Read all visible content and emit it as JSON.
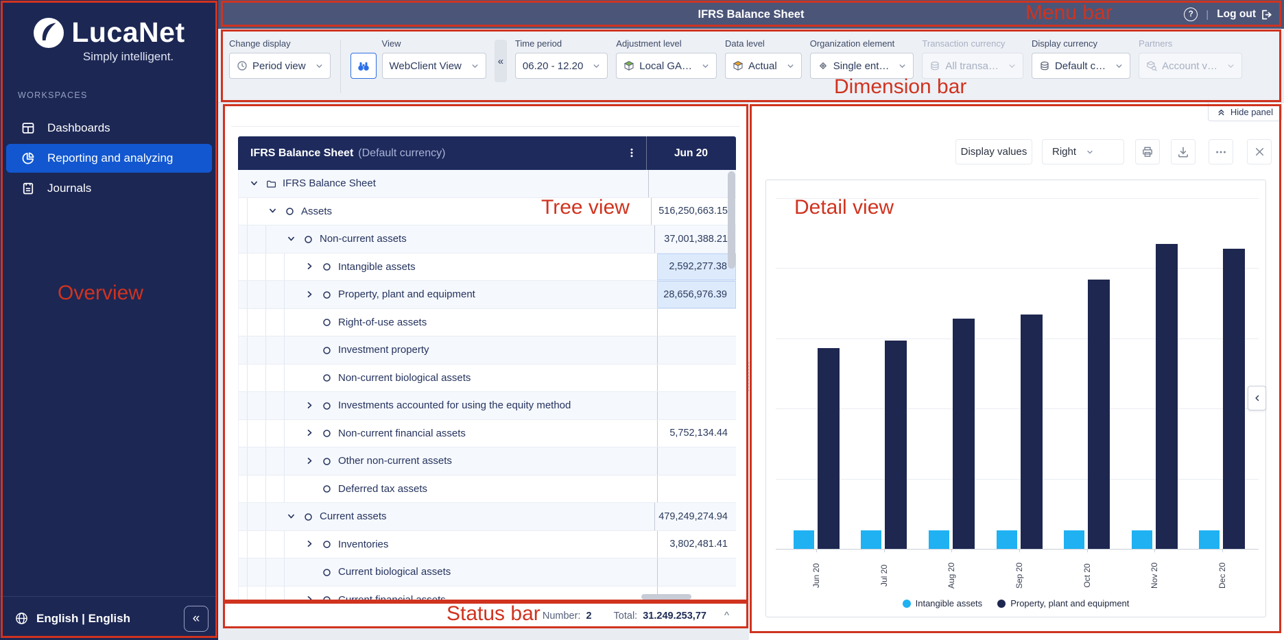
{
  "colors": {
    "accent": "#1257d0",
    "sidebar_bg": "#1c2754",
    "menubar_bg": "#4b5578",
    "tree_header_bg": "#1e2a5c",
    "bar_blue": "#1fb1f2",
    "bar_navy": "#1d2750",
    "annotation_red": "#d0331f"
  },
  "annotations": {
    "menu_bar": "Menu bar",
    "dimension_bar": "Dimension bar",
    "overview": "Overview",
    "tree_view": "Tree view",
    "detail_view": "Detail view",
    "status_bar": "Status bar"
  },
  "sidebar": {
    "logo_text": "LucaNet",
    "tagline": "Simply intelligent.",
    "section_label": "WORKSPACES",
    "items": [
      {
        "label": "Dashboards",
        "icon": "dashboard",
        "selected": false
      },
      {
        "label": "Reporting and analyzing",
        "icon": "pie",
        "selected": true
      },
      {
        "label": "Journals",
        "icon": "journal",
        "selected": false
      }
    ],
    "language": "English | English",
    "collapse_glyph": "«"
  },
  "menu_bar": {
    "title": "IFRS Balance Sheet",
    "help_glyph": "?",
    "divider_glyph": "|",
    "logout_label": "Log out"
  },
  "dimension_bar": {
    "controls": [
      {
        "type": "field",
        "label": "Change display",
        "value": "Period view",
        "icon": "clock",
        "disabled": false
      },
      {
        "type": "separator"
      },
      {
        "type": "field",
        "label": "View",
        "value": "WebClient View",
        "icon": null,
        "prefix_button": "binoculars",
        "disabled": false
      },
      {
        "type": "collapse",
        "glyph": "«"
      },
      {
        "type": "field",
        "label": "Time period",
        "value": "06.20 - 12.20",
        "icon": null,
        "disabled": false
      },
      {
        "type": "field",
        "label": "Adjustment level",
        "value": "Local GA…",
        "icon": "cube-green",
        "disabled": false
      },
      {
        "type": "field",
        "label": "Data level",
        "value": "Actual",
        "icon": "cube-orange",
        "disabled": false
      },
      {
        "type": "field",
        "label": "Organization element",
        "value": "Single ent…",
        "icon": "diamond",
        "disabled": false
      },
      {
        "type": "field",
        "label": "Transaction currency",
        "value": "All transa…",
        "icon": "coins",
        "disabled": true
      },
      {
        "type": "field",
        "label": "Display currency",
        "value": "Default c…",
        "icon": "coins",
        "disabled": false
      },
      {
        "type": "field",
        "label": "Partners",
        "value": "Account v…",
        "icon": "box-search",
        "disabled": true
      }
    ]
  },
  "tree": {
    "header_title": "IFRS Balance Sheet",
    "header_subtitle": "(Default currency)",
    "column_header": "Jun 20",
    "rows": [
      {
        "level": 0,
        "chevron": "down",
        "node": "folder",
        "label": "IFRS Balance Sheet",
        "value": "",
        "selected": false
      },
      {
        "level": 1,
        "chevron": "down",
        "node": "circle",
        "label": "Assets",
        "value": "516,250,663.15",
        "selected": false
      },
      {
        "level": 2,
        "chevron": "down",
        "node": "circle",
        "label": "Non-current assets",
        "value": "37,001,388.21",
        "selected": false
      },
      {
        "level": 3,
        "chevron": "right",
        "node": "circle",
        "label": "Intangible assets",
        "value": "2,592,277.38",
        "selected": true
      },
      {
        "level": 3,
        "chevron": "right",
        "node": "circle",
        "label": "Property, plant and equipment",
        "value": "28,656,976.39",
        "selected": true
      },
      {
        "level": 3,
        "chevron": "none",
        "node": "circle",
        "label": "Right-of-use assets",
        "value": "",
        "selected": false
      },
      {
        "level": 3,
        "chevron": "none",
        "node": "circle",
        "label": "Investment property",
        "value": "",
        "selected": false
      },
      {
        "level": 3,
        "chevron": "none",
        "node": "circle",
        "label": "Non-current biological assets",
        "value": "",
        "selected": false
      },
      {
        "level": 3,
        "chevron": "right",
        "node": "circle",
        "label": "Investments accounted for using the equity method",
        "value": "",
        "selected": false
      },
      {
        "level": 3,
        "chevron": "right",
        "node": "circle",
        "label": "Non-current financial assets",
        "value": "5,752,134.44",
        "selected": false
      },
      {
        "level": 3,
        "chevron": "right",
        "node": "circle",
        "label": "Other non-current assets",
        "value": "",
        "selected": false
      },
      {
        "level": 3,
        "chevron": "none",
        "node": "circle",
        "label": "Deferred tax assets",
        "value": "",
        "selected": false
      },
      {
        "level": 2,
        "chevron": "down",
        "node": "circle",
        "label": "Current assets",
        "value": "479,249,274.94",
        "selected": false
      },
      {
        "level": 3,
        "chevron": "right",
        "node": "circle",
        "label": "Inventories",
        "value": "3,802,481.41",
        "selected": false
      },
      {
        "level": 3,
        "chevron": "none",
        "node": "circle",
        "label": "Current biological assets",
        "value": "",
        "selected": false
      },
      {
        "level": 3,
        "chevron": "right",
        "node": "circle",
        "label": "Current financial assets",
        "value": "",
        "selected": false
      }
    ]
  },
  "status_bar": {
    "number_label": "Number:",
    "number_value": "2",
    "total_label": "Total:",
    "total_value": "31.249.253,77",
    "caret_glyph": "^"
  },
  "detail": {
    "hide_panel_label": "Hide panel",
    "display_values_label": "Display values",
    "position_value": "Right"
  },
  "chart_data": {
    "type": "bar",
    "categories": [
      "Jun 20",
      "Jul 20",
      "Aug 20",
      "Sep 20",
      "Oct 20",
      "Nov 20",
      "Dec 20"
    ],
    "series": [
      {
        "name": "Intangible assets",
        "color": "#1fb1f2",
        "values": [
          2592277,
          2592277,
          2592277,
          2592277,
          2592277,
          2592277,
          2592277
        ]
      },
      {
        "name": "Property, plant and equipment",
        "color": "#1d2750",
        "values": [
          28656976,
          29700000,
          32800000,
          33400000,
          38400000,
          43500000,
          42800000
        ]
      }
    ],
    "title": "",
    "xlabel": "",
    "ylabel": "",
    "ylim": [
      0,
      50000000
    ],
    "gridline_step": 10000000,
    "grid": true,
    "legend_position": "bottom",
    "x_tick_rotation": -90
  }
}
